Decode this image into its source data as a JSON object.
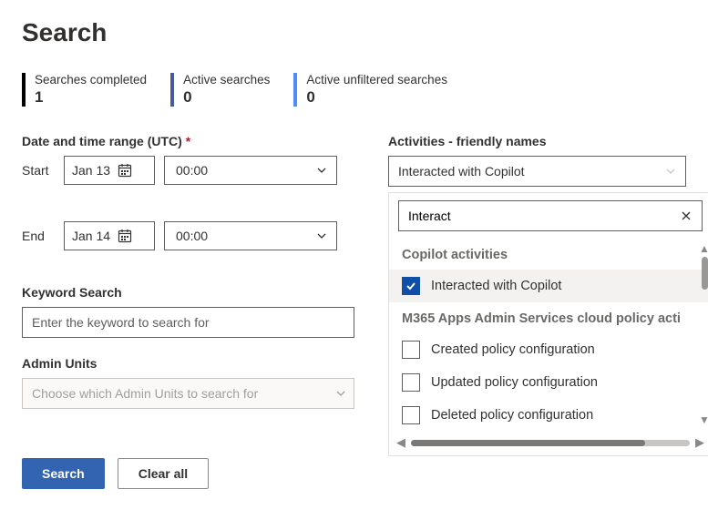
{
  "page_title": "Search",
  "stats": {
    "completed": {
      "label": "Searches completed",
      "value": "1"
    },
    "active": {
      "label": "Active searches",
      "value": "0"
    },
    "unfiltered": {
      "label": "Active unfiltered searches",
      "value": "0"
    }
  },
  "date_range": {
    "label": "Date and time range (UTC)",
    "required_marker": "*",
    "start_caption": "Start",
    "end_caption": "End",
    "start_date": "Jan 13",
    "start_time": "00:00",
    "end_date": "Jan 14",
    "end_time": "00:00"
  },
  "keyword": {
    "label": "Keyword Search",
    "placeholder": "Enter the keyword to search for",
    "value": ""
  },
  "admin_units": {
    "label": "Admin Units",
    "placeholder": "Choose which Admin Units to search for"
  },
  "buttons": {
    "search": "Search",
    "clear": "Clear all"
  },
  "activities": {
    "label": "Activities - friendly names",
    "selected_display": "Interacted with Copilot",
    "filter_value": "Interact",
    "groups": [
      {
        "header": "Copilot activities",
        "items": [
          {
            "label": "Interacted with Copilot",
            "checked": true
          }
        ]
      },
      {
        "header": "M365 Apps Admin Services cloud policy acti",
        "items": [
          {
            "label": "Created policy configuration",
            "checked": false
          },
          {
            "label": "Updated policy configuration",
            "checked": false
          },
          {
            "label": "Deleted policy configuration",
            "checked": false
          }
        ]
      }
    ]
  },
  "icons": {
    "calendar": "calendar-icon",
    "chevron_down": "chevron-down-icon",
    "close": "close-icon",
    "check": "check-icon"
  }
}
